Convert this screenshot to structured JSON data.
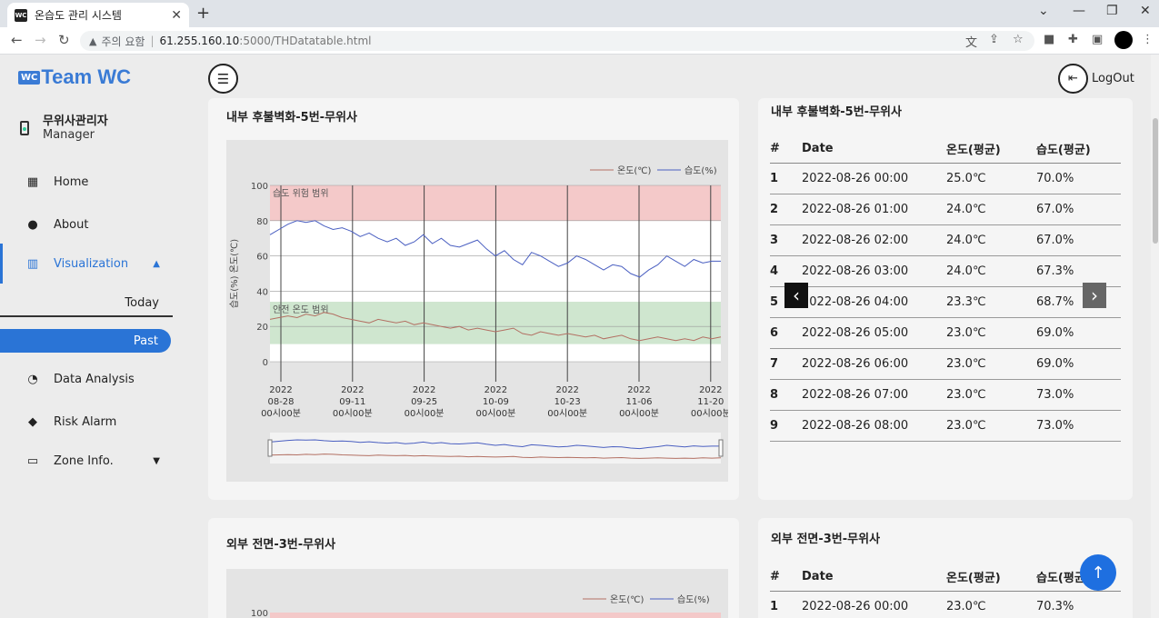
{
  "browser": {
    "tab_title": "온습도 관리 시스템",
    "tab_favicon": "WC",
    "security_label": "주의 요함",
    "url_host": "61.255.160.10",
    "url_rest": ":5000/THDatatable.html"
  },
  "sidebar": {
    "logo_badge": "WC",
    "logo_text": "Team WC",
    "user_name": "무위사관리자",
    "user_role": "Manager",
    "items": [
      {
        "label": "Home",
        "icon": "grid-icon"
      },
      {
        "label": "About",
        "icon": "chat-icon"
      },
      {
        "label": "Visualization",
        "icon": "chart-icon"
      },
      {
        "label": "Data Analysis",
        "icon": "gauge-icon"
      },
      {
        "label": "Risk Alarm",
        "icon": "alert-icon"
      },
      {
        "label": "Zone Info.",
        "icon": "laptop-icon"
      }
    ],
    "sub_items": [
      "Today",
      "Past"
    ]
  },
  "header": {
    "logout_label": "LogOut"
  },
  "accent_color": "#2a74d6",
  "cards": {
    "chart1_title": "내부 후불벽화-5번-무위사",
    "table1_title": "내부 후불벽화-5번-무위사",
    "chart2_title": "외부 전면-3번-무위사",
    "table2_title": "외부 전면-3번-무위사"
  },
  "table": {
    "headers": [
      "#",
      "Date",
      "온도(평균)",
      "습도(평균)"
    ],
    "rows": [
      [
        "1",
        "2022-08-26 00:00",
        "25.0℃",
        "70.0%"
      ],
      [
        "2",
        "2022-08-26 01:00",
        "24.0℃",
        "67.0%"
      ],
      [
        "3",
        "2022-08-26 02:00",
        "24.0℃",
        "67.0%"
      ],
      [
        "4",
        "2022-08-26 03:00",
        "24.0℃",
        "67.3%"
      ],
      [
        "5",
        "2022-08-26 04:00",
        "23.3℃",
        "68.7%"
      ],
      [
        "6",
        "2022-08-26 05:00",
        "23.0℃",
        "69.0%"
      ],
      [
        "7",
        "2022-08-26 06:00",
        "23.0℃",
        "69.0%"
      ],
      [
        "8",
        "2022-08-26 07:00",
        "23.0℃",
        "73.0%"
      ],
      [
        "9",
        "2022-08-26 08:00",
        "23.0℃",
        "73.0%"
      ]
    ],
    "rows2": [
      [
        "1",
        "2022-08-26 00:00",
        "23.0℃",
        "70.3%"
      ]
    ]
  },
  "chart_data": [
    {
      "type": "line",
      "ylabel": "습도(%)  온도(℃)",
      "ylim": [
        0,
        100
      ],
      "yticks": [
        0,
        20,
        40,
        60,
        80,
        100
      ],
      "x_ticks": [
        [
          "2022",
          "08-28",
          "00시00분"
        ],
        [
          "2022",
          "09-11",
          "00시00분"
        ],
        [
          "2022",
          "09-25",
          "00시00분"
        ],
        [
          "2022",
          "10-09",
          "00시00분"
        ],
        [
          "2022",
          "10-23",
          "00시00분"
        ],
        [
          "2022",
          "11-06",
          "00시00분"
        ],
        [
          "2022",
          "11-20",
          "00시00분"
        ]
      ],
      "bands": [
        {
          "label": "습도 위험 범위",
          "from": 80,
          "to": 100,
          "color": "#f4c9c9"
        },
        {
          "label": "안전 온도 범위",
          "from": 10,
          "to": 34,
          "color": "#cfe6cf"
        }
      ],
      "legend": "top-right",
      "series": [
        {
          "name": "습도(%)",
          "color": "#4a5fc1",
          "values": [
            72,
            75,
            78,
            80,
            79,
            80,
            77,
            75,
            76,
            74,
            71,
            73,
            70,
            68,
            70,
            66,
            68,
            72,
            67,
            70,
            66,
            65,
            67,
            69,
            64,
            60,
            63,
            58,
            55,
            62,
            60,
            57,
            54,
            56,
            60,
            58,
            55,
            52,
            55,
            54,
            50,
            48,
            52,
            55,
            60,
            57,
            54,
            58,
            56,
            57,
            57
          ]
        },
        {
          "name": "온도(℃)",
          "color": "#b37063",
          "values": [
            24,
            25,
            26,
            25,
            27,
            26,
            28,
            27,
            25,
            24,
            23,
            22,
            24,
            23,
            22,
            23,
            21,
            22,
            21,
            20,
            19,
            20,
            18,
            19,
            18,
            17,
            18,
            19,
            16,
            15,
            17,
            16,
            15,
            16,
            15,
            14,
            15,
            13,
            14,
            15,
            13,
            12,
            13,
            14,
            13,
            12,
            13,
            12,
            14,
            13,
            14
          ]
        }
      ]
    },
    {
      "type": "line",
      "legend": "top-right",
      "yticks": [
        100
      ],
      "series": [
        {
          "name": "온도(℃)",
          "color": "#b37063"
        },
        {
          "name": "습도(%)",
          "color": "#4a5fc1"
        }
      ]
    }
  ]
}
